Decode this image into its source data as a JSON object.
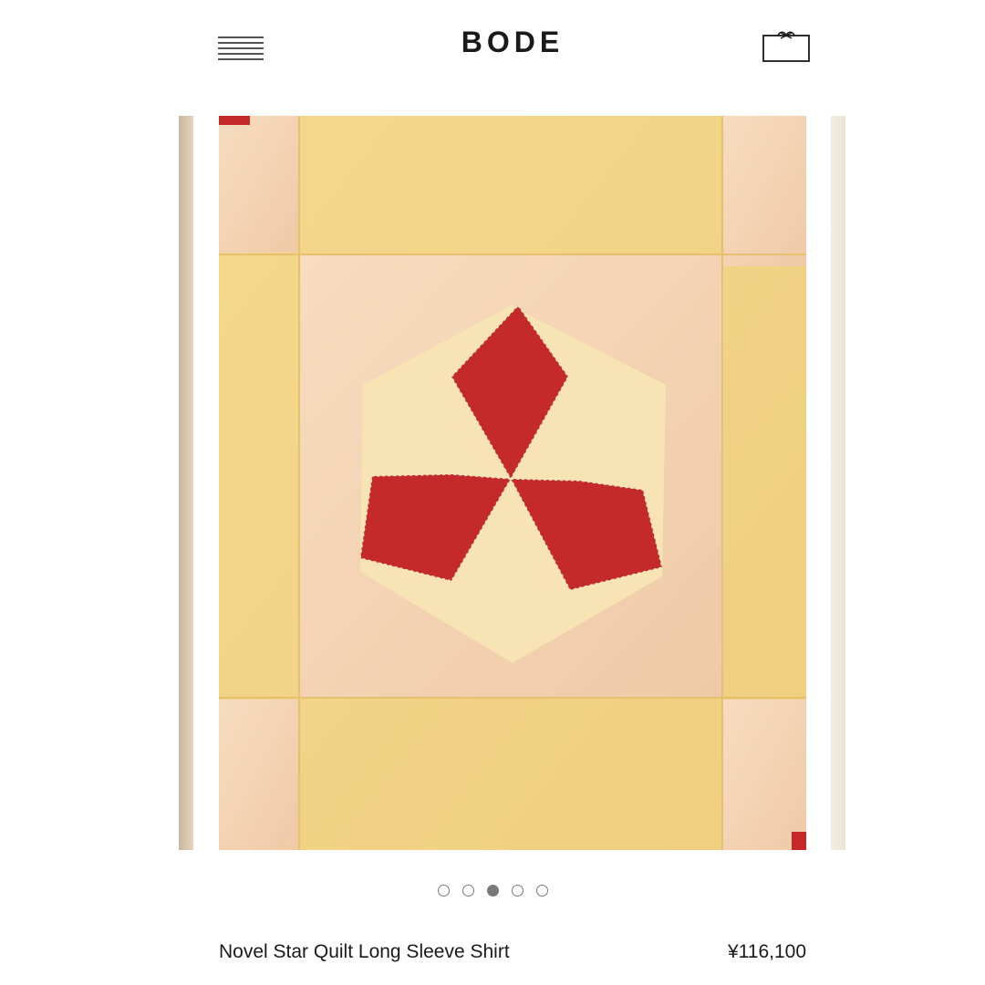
{
  "header": {
    "logo": "BODE",
    "menu_icon": "hamburger-menu-icon",
    "bag_icon": "shopping-bag-icon"
  },
  "carousel": {
    "slide_count": 5,
    "active_index": 2,
    "image_subject": "quilted fabric with red and cream six-point star patchwork",
    "colors": {
      "yellow": "#f2d58a",
      "peach": "#f3d3b2",
      "cream": "#f7e3b4",
      "red": "#c42a2a"
    }
  },
  "product": {
    "name": "Novel Star Quilt Long Sleeve Shirt",
    "price": "¥116,100"
  }
}
